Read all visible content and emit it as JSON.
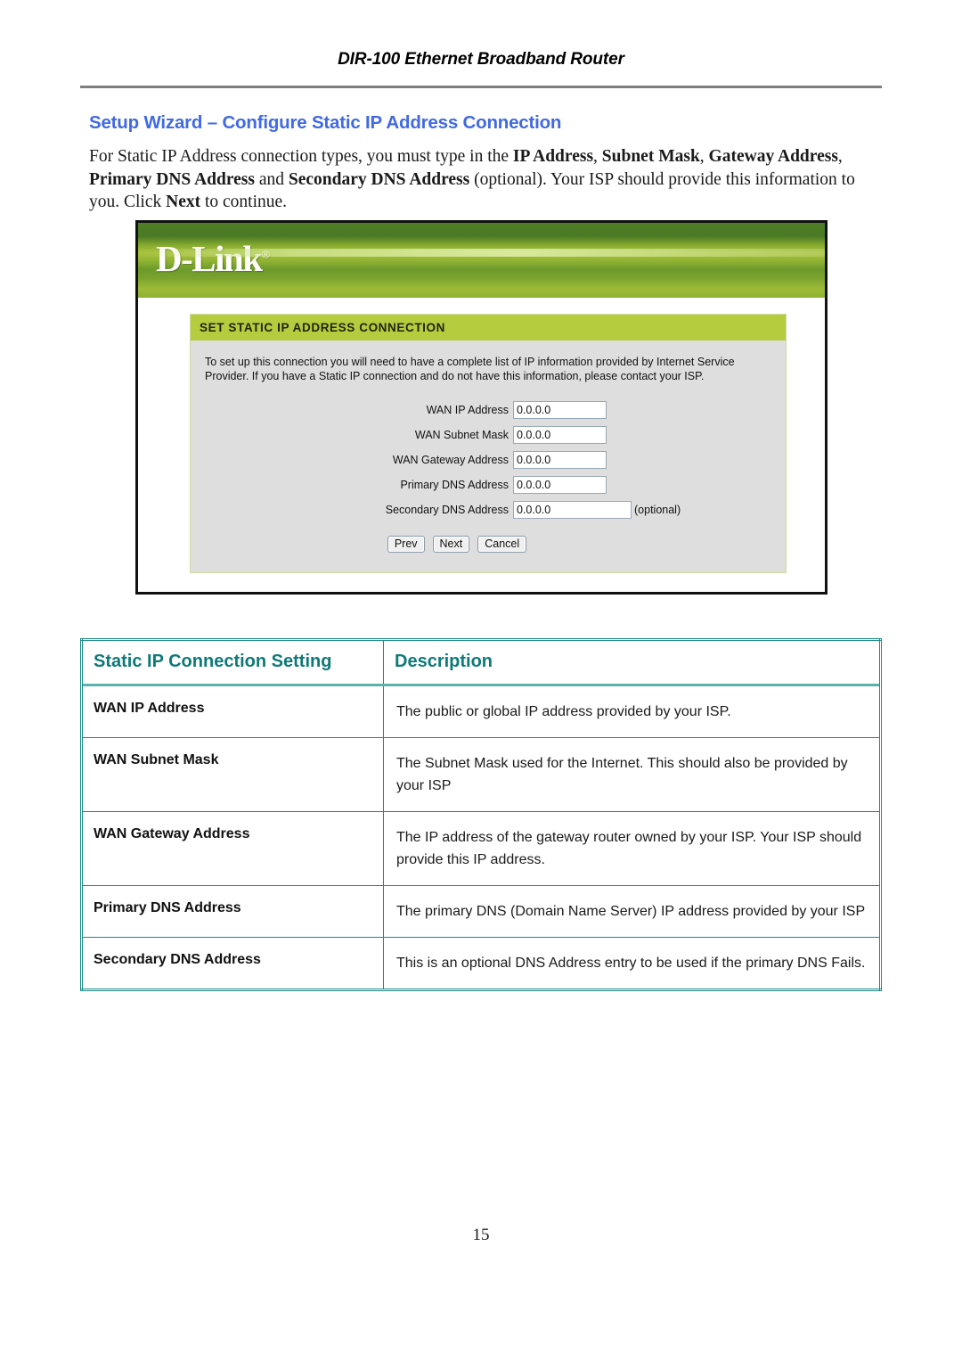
{
  "header": {
    "running_title": "DIR-100 Ethernet Broadband Router"
  },
  "section": {
    "heading": "Setup Wizard – Configure Static IP Address Connection",
    "intro_segments": [
      {
        "text": "For Static IP Address connection types, you must type in the ",
        "bold": false
      },
      {
        "text": "IP Address",
        "bold": true
      },
      {
        "text": ", ",
        "bold": false
      },
      {
        "text": "Subnet Mask",
        "bold": true
      },
      {
        "text": ", ",
        "bold": false
      },
      {
        "text": "Gateway Address",
        "bold": true
      },
      {
        "text": ", ",
        "bold": false
      },
      {
        "text": "Primary DNS Address",
        "bold": true
      },
      {
        "text": " and ",
        "bold": false
      },
      {
        "text": "Secondary DNS Address",
        "bold": true
      },
      {
        "text": " (optional). Your ISP should provide this information to you. Click ",
        "bold": false
      },
      {
        "text": "Next",
        "bold": true
      },
      {
        "text": " to continue.",
        "bold": false
      }
    ]
  },
  "screenshot": {
    "brand_logo": "D-Link",
    "brand_registered_mark": "®",
    "panel_title": "SET STATIC IP ADDRESS CONNECTION",
    "panel_description": "To set up this connection you will need to have a complete list of IP information provided by Internet Service Provider. If you have a Static IP connection and do not have this information, please contact your ISP.",
    "fields": [
      {
        "label": "WAN IP Address",
        "value": "0.0.0.0",
        "note": "",
        "wide": false
      },
      {
        "label": "WAN Subnet Mask",
        "value": "0.0.0.0",
        "note": "",
        "wide": false
      },
      {
        "label": "WAN Gateway Address",
        "value": "0.0.0.0",
        "note": "",
        "wide": false
      },
      {
        "label": "Primary DNS Address",
        "value": "0.0.0.0",
        "note": "",
        "wide": false
      },
      {
        "label": "Secondary DNS Address",
        "value": "0.0.0.0",
        "note": "(optional)",
        "wide": true
      }
    ],
    "buttons": [
      {
        "label": "Prev"
      },
      {
        "label": "Next"
      },
      {
        "label": "Cancel"
      }
    ],
    "colors": {
      "banner_green_dark": "#4e7d27",
      "banner_green_light": "#a8c23c",
      "panel_title_bg": "#b5cc3f",
      "panel_body_bg": "#dedede"
    }
  },
  "table": {
    "columns": [
      "Static IP Connection Setting",
      "Description"
    ],
    "rows": [
      {
        "setting": "WAN IP Address",
        "description": "The public or global IP address provided by your ISP."
      },
      {
        "setting": "WAN Subnet Mask",
        "description": "The Subnet Mask used for the Internet. This should also be provided by your ISP"
      },
      {
        "setting": "WAN Gateway Address",
        "description": "The IP address of the gateway router owned by your ISP. Your ISP should provide this IP address."
      },
      {
        "setting": "Primary DNS Address",
        "description": "The primary DNS (Domain Name Server) IP address provided by your ISP"
      },
      {
        "setting": "Secondary DNS Address",
        "description": "This is an optional DNS Address entry to be used if the primary DNS Fails."
      }
    ],
    "header_color": "#0d7a78",
    "border_color": "#1c8b86"
  },
  "footer": {
    "page_number": "15"
  }
}
